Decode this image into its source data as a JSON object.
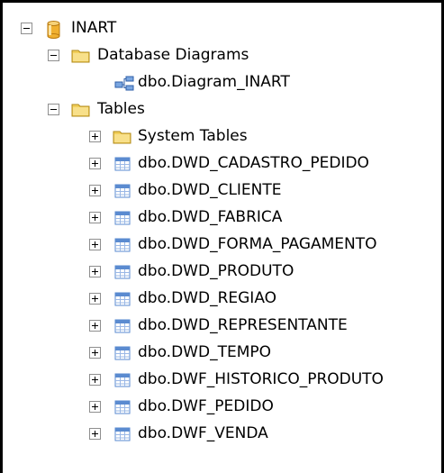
{
  "tree": {
    "database": {
      "label": "INART",
      "expanded": true,
      "icon": "database-icon"
    },
    "diagrams_folder": {
      "label": "Database Diagrams",
      "expanded": true,
      "icon": "folder-icon"
    },
    "diagram": {
      "label": "dbo.Diagram_INART",
      "icon": "diagram-icon"
    },
    "tables_folder": {
      "label": "Tables",
      "expanded": true,
      "icon": "folder-icon"
    },
    "system_tables": {
      "label": "System Tables",
      "expanded": false,
      "icon": "folder-icon"
    },
    "tables": [
      {
        "label": "dbo.DWD_CADASTRO_PEDIDO"
      },
      {
        "label": "dbo.DWD_CLIENTE"
      },
      {
        "label": "dbo.DWD_FABRICA"
      },
      {
        "label": "dbo.DWD_FORMA_PAGAMENTO"
      },
      {
        "label": "dbo.DWD_PRODUTO"
      },
      {
        "label": "dbo.DWD_REGIAO"
      },
      {
        "label": "dbo.DWD_REPRESENTANTE"
      },
      {
        "label": "dbo.DWD_TEMPO"
      },
      {
        "label": "dbo.DWF_HISTORICO_PRODUTO"
      },
      {
        "label": "dbo.DWF_PEDIDO"
      },
      {
        "label": "dbo.DWF_VENDA"
      }
    ]
  },
  "colors": {
    "folder": "#f2cf5a",
    "database": "#f0b030",
    "table": "#5b8bd0"
  }
}
